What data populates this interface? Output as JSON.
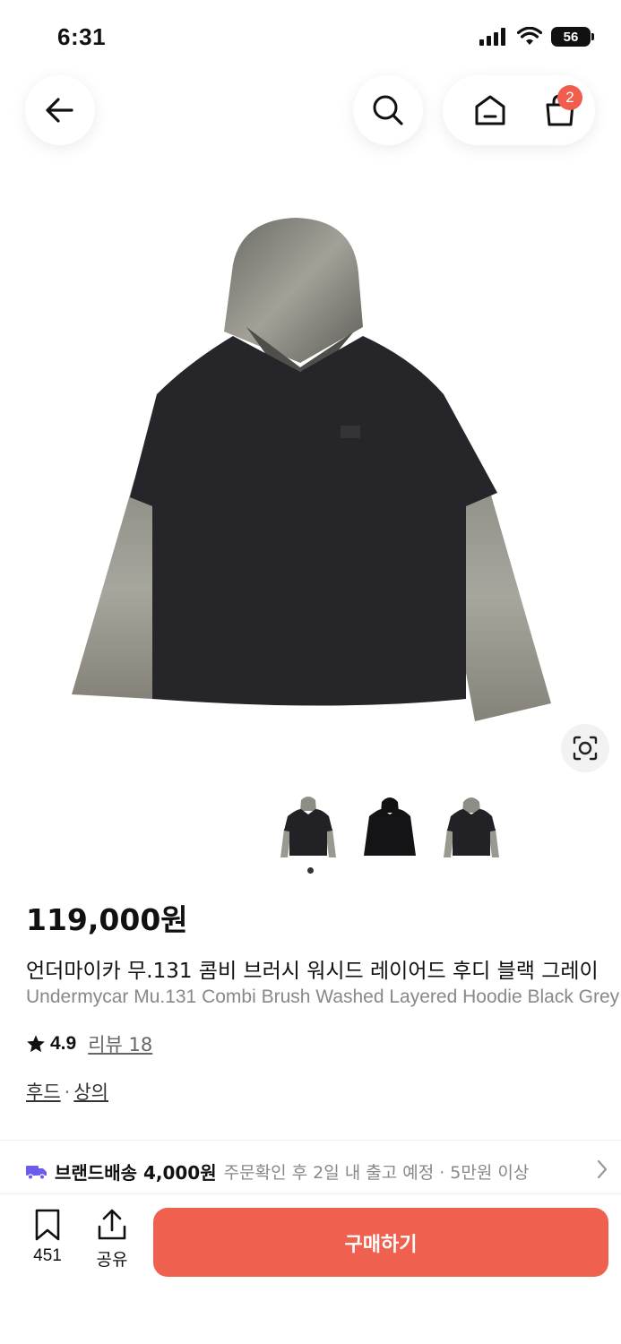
{
  "status_bar": {
    "time": "6:31",
    "battery": "56"
  },
  "nav": {
    "cart_count": "2"
  },
  "product": {
    "price": "119,000원",
    "name_ko": "언더마이카 무.131 콤비 브러시 워시드 레이어드 후디 블랙 그레이",
    "name_en": "Undermycar Mu.131 Combi Brush Washed Layered Hoodie Black Grey",
    "rating": "4.9",
    "review_label": "리뷰 18",
    "categories": [
      "후드",
      "상의"
    ],
    "category_sep": "·"
  },
  "shipping": {
    "label": "브랜드배송 4,000원",
    "note": "주문확인 후 2일 내 출고 예정 · 5만원 이상"
  },
  "bottom_bar": {
    "save_count": "451",
    "share_label": "공유",
    "buy_label": "구매하기"
  },
  "colors": {
    "accent": "#f0604f",
    "badge": "#f05d4f",
    "shipping_icon": "#6b5cf0"
  },
  "icons": [
    "back-arrow-icon",
    "search-icon",
    "home-icon",
    "shopping-bag-icon",
    "lens-search-icon",
    "truck-icon",
    "chevron-right-icon",
    "star-icon",
    "bookmark-icon",
    "share-icon"
  ]
}
